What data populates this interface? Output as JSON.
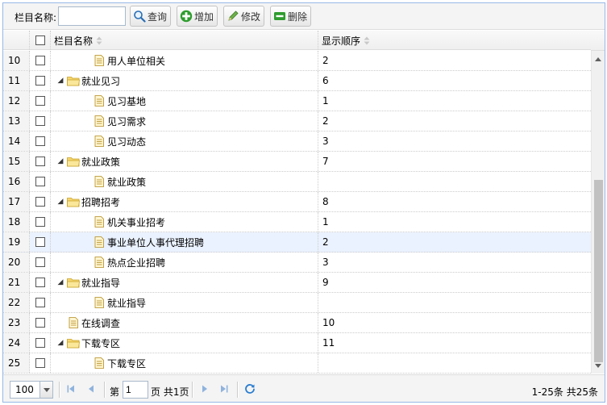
{
  "toolbar": {
    "search_label": "栏目名称:",
    "search_value": "",
    "query_label": "查询",
    "add_label": "增加",
    "edit_label": "修改",
    "delete_label": "删除"
  },
  "table": {
    "columns": [
      "栏目名称",
      "显示顺序"
    ],
    "rows": [
      {
        "num": "10",
        "name": "用人单位相关",
        "order": "2",
        "level": 1,
        "type": "file"
      },
      {
        "num": "11",
        "name": "就业见习",
        "order": "6",
        "level": 0,
        "type": "folder"
      },
      {
        "num": "12",
        "name": "见习基地",
        "order": "1",
        "level": 1,
        "type": "file"
      },
      {
        "num": "13",
        "name": "见习需求",
        "order": "2",
        "level": 1,
        "type": "file"
      },
      {
        "num": "14",
        "name": "见习动态",
        "order": "3",
        "level": 1,
        "type": "file"
      },
      {
        "num": "15",
        "name": "就业政策",
        "order": "7",
        "level": 0,
        "type": "folder"
      },
      {
        "num": "16",
        "name": "就业政策",
        "order": "",
        "level": 1,
        "type": "file"
      },
      {
        "num": "17",
        "name": "招聘招考",
        "order": "8",
        "level": 0,
        "type": "folder"
      },
      {
        "num": "18",
        "name": "机关事业招考",
        "order": "1",
        "level": 1,
        "type": "file"
      },
      {
        "num": "19",
        "name": "事业单位人事代理招聘",
        "order": "2",
        "level": 1,
        "type": "file",
        "selected": true
      },
      {
        "num": "20",
        "name": "热点企业招聘",
        "order": "3",
        "level": 1,
        "type": "file"
      },
      {
        "num": "21",
        "name": "就业指导",
        "order": "9",
        "level": 0,
        "type": "folder"
      },
      {
        "num": "22",
        "name": "就业指导",
        "order": "",
        "level": 1,
        "type": "file"
      },
      {
        "num": "23",
        "name": "在线调查",
        "order": "10",
        "level": 0,
        "type": "file"
      },
      {
        "num": "24",
        "name": "下载专区",
        "order": "11",
        "level": 0,
        "type": "folder"
      },
      {
        "num": "25",
        "name": "下载专区",
        "order": "",
        "level": 1,
        "type": "file"
      }
    ]
  },
  "pager": {
    "page_size": "100",
    "page_prefix": "第",
    "page_value": "1",
    "page_suffix": "页 共1页",
    "info": "1-25条 共25条"
  },
  "icons": {
    "folder": "folder-icon",
    "file": "file-icon",
    "query": "search-icon",
    "add": "plus-icon",
    "edit": "pencil-icon",
    "delete": "minus-icon"
  },
  "colors": {
    "border": "#95b8e7",
    "selected_row": "#eaf2ff",
    "folder": "#f5d66f",
    "add_green": "#2e9c2e",
    "pager_blue": "#4a90d9"
  }
}
